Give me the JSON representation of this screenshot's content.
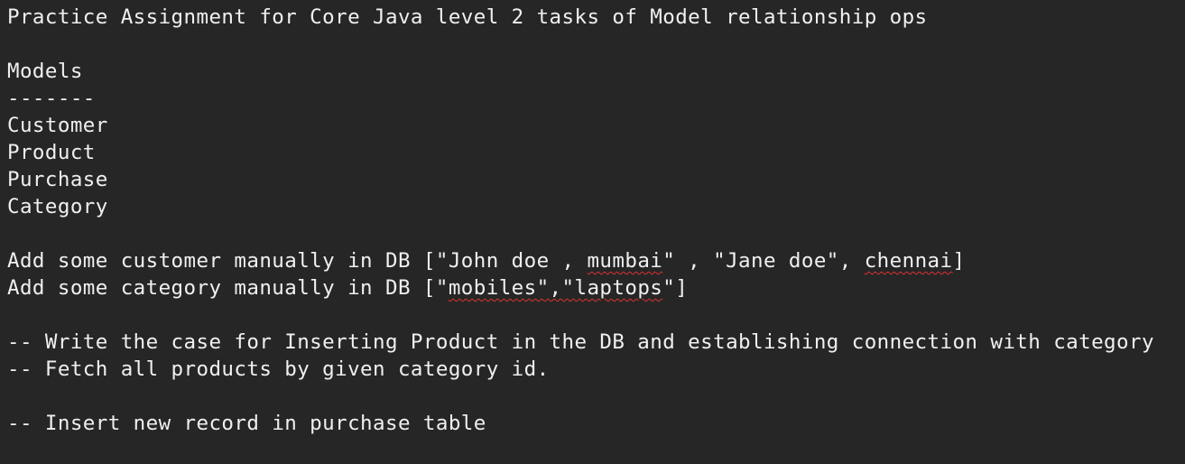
{
  "editor": {
    "lines": [
      [
        {
          "t": "Practice Assignment for Core Java level 2 tasks of Model relationship ops"
        }
      ],
      [
        {
          "t": ""
        }
      ],
      [
        {
          "t": "Models"
        }
      ],
      [
        {
          "t": "-------"
        }
      ],
      [
        {
          "t": "Customer"
        }
      ],
      [
        {
          "t": "Product"
        }
      ],
      [
        {
          "t": "Purchase"
        }
      ],
      [
        {
          "t": "Category"
        }
      ],
      [
        {
          "t": ""
        }
      ],
      [
        {
          "t": "Add some customer manually in DB [\"John doe , "
        },
        {
          "t": "mumbai",
          "spell": true
        },
        {
          "t": "\" , \"Jane doe\", "
        },
        {
          "t": "chennai",
          "spell": true
        },
        {
          "t": "]"
        }
      ],
      [
        {
          "t": "Add some category manually in DB [\""
        },
        {
          "t": "mobiles\",\"laptops",
          "spell": true
        },
        {
          "t": "\"]"
        }
      ],
      [
        {
          "t": ""
        }
      ],
      [
        {
          "t": "-- Write the case for Inserting Product in the DB and establishing connection with category"
        }
      ],
      [
        {
          "t": "-- Fetch all products by given category id."
        }
      ],
      [
        {
          "t": ""
        }
      ],
      [
        {
          "t": "-- Insert new record in purchase table"
        }
      ]
    ]
  },
  "colors": {
    "background": "#262626",
    "text": "#f0f0f0",
    "spellcheck": "#e03030"
  }
}
